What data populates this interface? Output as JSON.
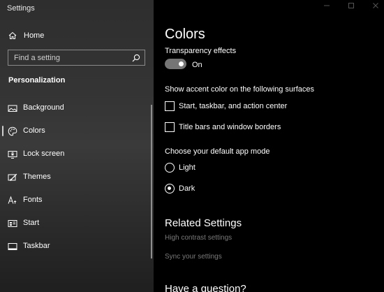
{
  "window": {
    "title": "Settings"
  },
  "sidebar": {
    "home_label": "Home",
    "search_placeholder": "Find a setting",
    "section_title": "Personalization",
    "items": [
      {
        "label": "Background",
        "icon": "image-icon"
      },
      {
        "label": "Colors",
        "icon": "palette-icon",
        "active": true
      },
      {
        "label": "Lock screen",
        "icon": "lock-screen-icon"
      },
      {
        "label": "Themes",
        "icon": "brush-icon"
      },
      {
        "label": "Fonts",
        "icon": "fonts-icon"
      },
      {
        "label": "Start",
        "icon": "start-icon"
      },
      {
        "label": "Taskbar",
        "icon": "taskbar-icon"
      }
    ]
  },
  "main": {
    "title": "Colors",
    "transparency": {
      "label": "Transparency effects",
      "state": "On",
      "enabled": true
    },
    "accent": {
      "label": "Show accent color on the following surfaces",
      "options": [
        {
          "label": "Start, taskbar, and action center",
          "checked": false
        },
        {
          "label": "Title bars and window borders",
          "checked": false
        }
      ]
    },
    "app_mode": {
      "label": "Choose your default app mode",
      "options": [
        {
          "label": "Light",
          "selected": false
        },
        {
          "label": "Dark",
          "selected": true
        }
      ]
    },
    "related": {
      "title": "Related Settings",
      "links": [
        "High contrast settings",
        "Sync your settings"
      ]
    },
    "question_title": "Have a question?"
  },
  "colors": {
    "background": "#000000",
    "sidebar": "#333333",
    "link": "#7a7a7a",
    "toggle_track": "#757575"
  }
}
